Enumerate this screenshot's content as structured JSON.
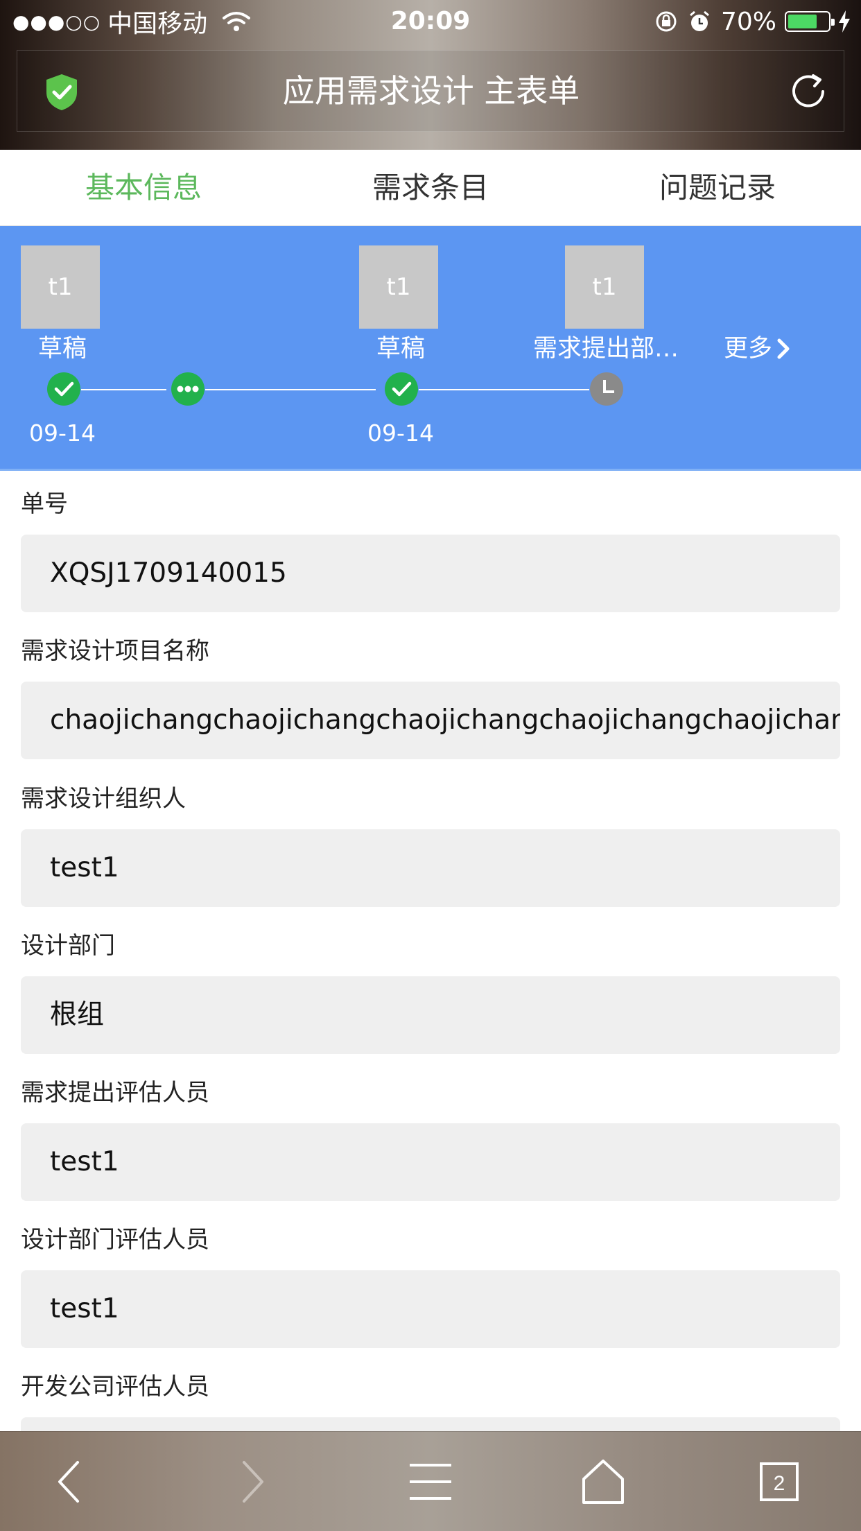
{
  "status_bar": {
    "signal": "●●●○○",
    "carrier": "中国移动",
    "time": "20:09",
    "battery_text": "70%",
    "battery_level": 0.7,
    "battery_color": "#4cd964"
  },
  "header": {
    "title": "应用需求设计 主表单",
    "left_icon": "shield-check-icon",
    "right_icon": "refresh-icon"
  },
  "tabs": [
    {
      "label": "基本信息",
      "active": true
    },
    {
      "label": "需求条目",
      "active": false
    },
    {
      "label": "问题记录",
      "active": false
    }
  ],
  "accent_color": "#5cb85c",
  "flow_band_color": "#5c96f2",
  "workflow": {
    "steps": [
      {
        "avatar": "t1",
        "label": "草稿",
        "date": "09-14",
        "status": "done"
      },
      {
        "avatar": "t1",
        "label": "草稿",
        "date": "09-14",
        "status": "done"
      },
      {
        "avatar": "t1",
        "label": "需求提出部…",
        "date": "",
        "status": "pending"
      }
    ],
    "intermediate_node": "in-progress",
    "more_label": "更多"
  },
  "form": {
    "fields": [
      {
        "label": "单号",
        "value": "XQSJ1709140015"
      },
      {
        "label": "需求设计项目名称",
        "value": "chaojichangchaojichangchaojichangchaojichangchaojichangchaojichang"
      },
      {
        "label": "需求设计组织人",
        "value": "test1"
      },
      {
        "label": "设计部门",
        "value": "根组"
      },
      {
        "label": "需求提出评估人员",
        "value": "test1"
      },
      {
        "label": "设计部门评估人员",
        "value": "test1"
      },
      {
        "label": "开发公司评估人员",
        "value": ""
      }
    ]
  },
  "toolbar": {
    "tab_count": "2",
    "icons": [
      "back-arrow-icon",
      "forward-arrow-icon",
      "menu-icon",
      "home-icon",
      "tabs-icon"
    ]
  }
}
